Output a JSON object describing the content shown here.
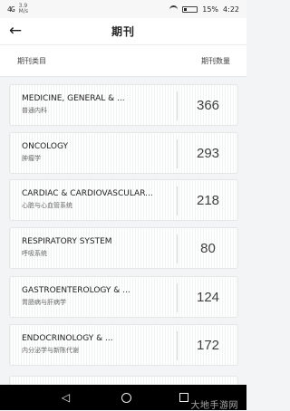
{
  "status_bar": {
    "signal": "4G",
    "speed_value": "3.9",
    "speed_unit": "M/s",
    "battery": "15%",
    "time": "4:22"
  },
  "header": {
    "title": "期刊"
  },
  "columns": {
    "category": "期刊类目",
    "count": "期刊数量"
  },
  "journals": [
    {
      "name": "MEDICINE, GENERAL & ...",
      "subtitle": "普通内科",
      "count": "366"
    },
    {
      "name": "ONCOLOGY",
      "subtitle": "肿瘤学",
      "count": "293"
    },
    {
      "name": "CARDIAC & CARDIOVASCULAR...",
      "subtitle": "心脏与心血管系统",
      "count": "218"
    },
    {
      "name": "RESPIRATORY SYSTEM",
      "subtitle": "呼吸系统",
      "count": "80"
    },
    {
      "name": "GASTROENTEROLOGY & ...",
      "subtitle": "胃肠病与肝病学",
      "count": "124"
    },
    {
      "name": "ENDOCRINOLOGY & ...",
      "subtitle": "内分泌学与新陈代谢",
      "count": "172"
    }
  ],
  "watermark": "大地手游网"
}
